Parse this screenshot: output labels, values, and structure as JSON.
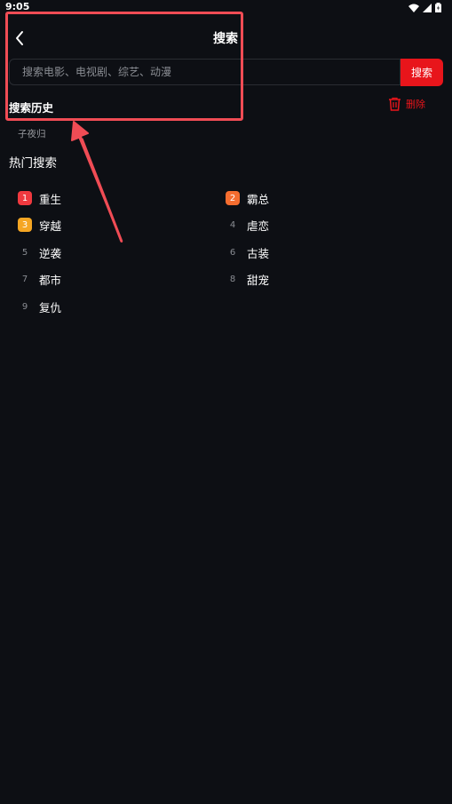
{
  "status_bar": {
    "time": "9:05"
  },
  "header": {
    "title": "搜索"
  },
  "search": {
    "placeholder": "搜索电影、电视剧、综艺、动漫",
    "button_label": "搜索"
  },
  "history": {
    "title": "搜索历史",
    "delete_label": "删除",
    "items": [
      "子夜归"
    ]
  },
  "hot": {
    "title": "热门搜索",
    "items": [
      {
        "rank": "1",
        "label": "重生",
        "badge_color": "#f0393f"
      },
      {
        "rank": "2",
        "label": "霸总",
        "badge_color": "#f56d2f"
      },
      {
        "rank": "3",
        "label": "穿越",
        "badge_color": "#f5a623"
      },
      {
        "rank": "4",
        "label": "虐恋"
      },
      {
        "rank": "5",
        "label": "逆袭"
      },
      {
        "rank": "6",
        "label": "古装"
      },
      {
        "rank": "7",
        "label": "都市"
      },
      {
        "rank": "8",
        "label": "甜宠"
      },
      {
        "rank": "9",
        "label": "复仇"
      }
    ]
  },
  "colors": {
    "accent": "#e8151b",
    "background": "#0d0f14",
    "annotation": "#f04c55"
  }
}
